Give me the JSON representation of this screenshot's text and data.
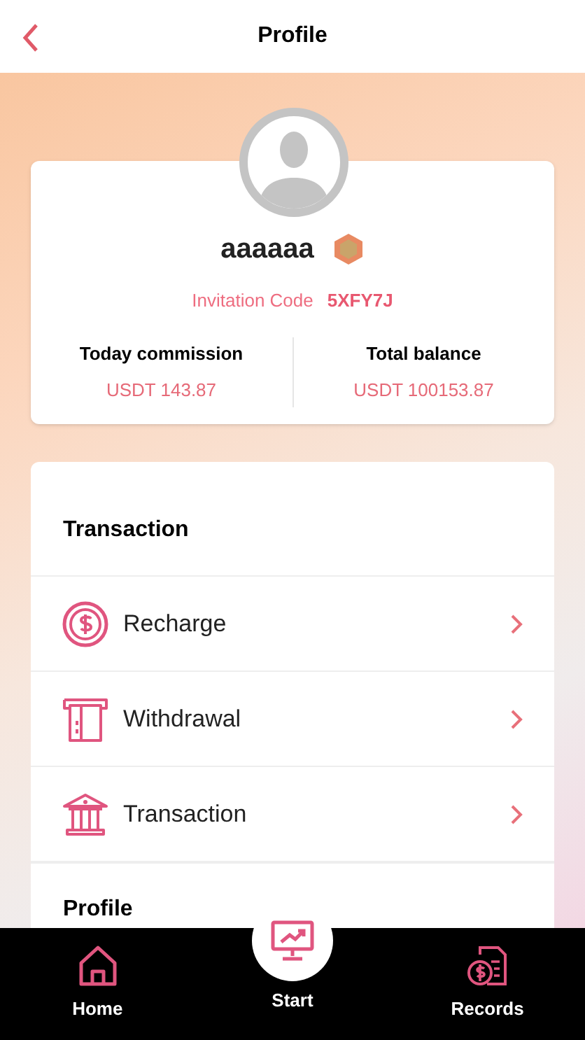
{
  "header": {
    "title": "Profile"
  },
  "user": {
    "name": "aaaaaa",
    "invitation_label": "Invitation Code",
    "invitation_code": "5XFY7J"
  },
  "stats": [
    {
      "label": "Today commission",
      "value": "USDT 143.87"
    },
    {
      "label": "Total balance",
      "value": "USDT 100153.87"
    }
  ],
  "sections": [
    {
      "title": "Transaction",
      "items": [
        {
          "label": "Recharge",
          "kind": "coin"
        },
        {
          "label": "Withdrawal",
          "kind": "atm"
        },
        {
          "label": "Transaction",
          "kind": "bank"
        }
      ]
    },
    {
      "title": "Profile"
    }
  ],
  "nav": [
    {
      "label": "Home",
      "kind": "home"
    },
    {
      "label": "Start",
      "kind": "start"
    },
    {
      "label": "Records",
      "kind": "records"
    }
  ]
}
